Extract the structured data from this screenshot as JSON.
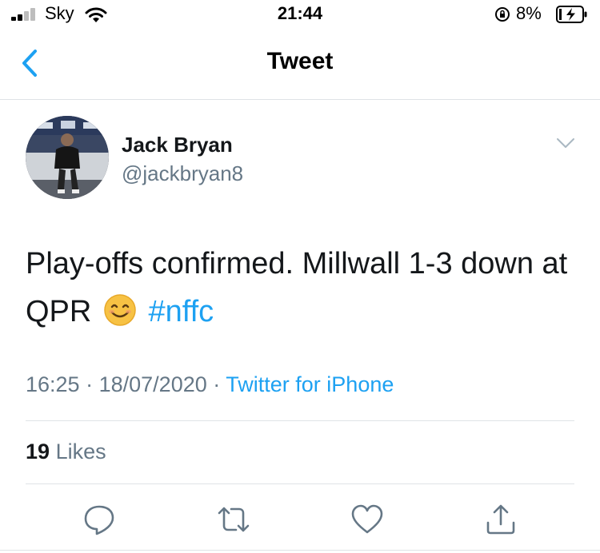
{
  "status_bar": {
    "carrier": "Sky",
    "time": "21:44",
    "battery_percent": "8%",
    "signal_bars": 2,
    "signal_bars_total": 4,
    "icons": [
      "signal-icon",
      "wifi-icon",
      "orientation-lock-icon",
      "battery-charging-icon"
    ]
  },
  "nav": {
    "title": "Tweet",
    "back_icon": "chevron-left-icon"
  },
  "tweet": {
    "author_name": "Jack Bryan",
    "handle": "@jackbryan8",
    "text_main": "Play-offs confirmed. Millwall 1-3 down at QPR",
    "emoji": "smiling-face-icon",
    "hashtag": "#nffc",
    "time": "16:25",
    "separator": "·",
    "date": "18/07/2020",
    "source": "Twitter for iPhone",
    "likes_count": "19",
    "likes_label": "Likes"
  },
  "actions": [
    "reply-icon",
    "retweet-icon",
    "like-icon",
    "share-icon"
  ],
  "colors": {
    "accent": "#1da1f2",
    "text_primary": "#14171a",
    "text_secondary": "#657786",
    "divider": "#dfe3e6",
    "action_icon": "#657786"
  }
}
